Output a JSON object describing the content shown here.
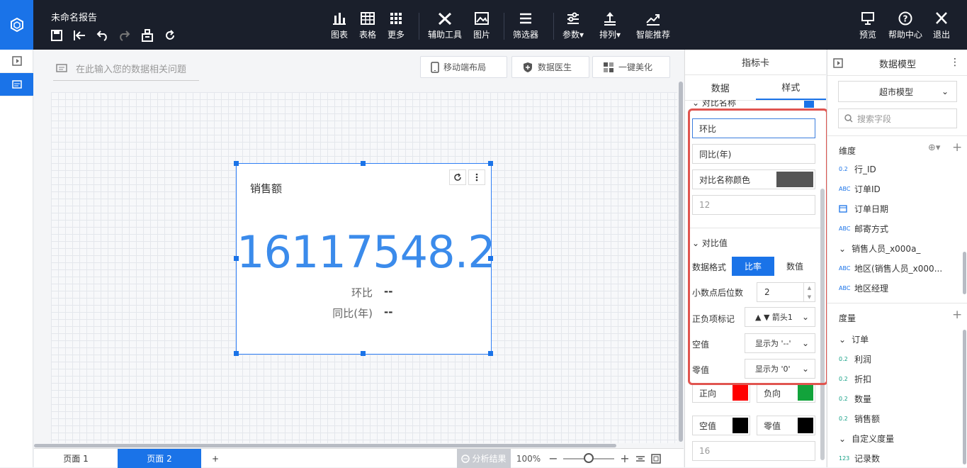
{
  "header": {
    "title": "未命名报告",
    "tools": [
      {
        "label": "图表",
        "icon": "bar-chart-icon"
      },
      {
        "label": "表格",
        "icon": "table-icon"
      },
      {
        "label": "更多",
        "icon": "grid-more-icon"
      },
      {
        "label": "辅助工具",
        "icon": "tools-icon"
      },
      {
        "label": "图片",
        "icon": "image-icon"
      },
      {
        "label": "筛选器",
        "icon": "filter-list-icon"
      },
      {
        "label": "参数",
        "icon": "params-icon"
      },
      {
        "label": "排列",
        "icon": "arrange-icon"
      },
      {
        "label": "智能推荐",
        "icon": "smart-recommend-icon"
      }
    ],
    "right": [
      {
        "label": "预览",
        "icon": "preview-icon"
      },
      {
        "label": "帮助中心",
        "icon": "help-icon"
      },
      {
        "label": "退出",
        "icon": "close-icon"
      }
    ]
  },
  "canvas": {
    "ask_placeholder": "在此输入您的数据相关问题",
    "mobile_layout": "移动端布局",
    "data_doctor": "数据医生",
    "beautify": "一键美化"
  },
  "card": {
    "title": "销售额",
    "value": "16117548.2",
    "cmp1_label": "环比",
    "cmp1_value": "--",
    "cmp2_label": "同比(年)",
    "cmp2_value": "--"
  },
  "pages": {
    "page1": "页面 1",
    "page2": "页面 2",
    "add": "+",
    "analysis": "分析结果",
    "zoom": "100%"
  },
  "panel": {
    "title": "指标卡",
    "tab_data": "数据",
    "tab_style": "样式",
    "section_cmp_name": "对比名称",
    "cmp_name_1": "环比",
    "cmp_name_2": "同比(年)",
    "cmp_name_color": "对比名称颜色",
    "font_size": "12",
    "section_cmp_value": "对比值",
    "data_format": "数据格式",
    "fmt_ratio": "比率",
    "fmt_value": "数值",
    "decimals_label": "小数点后位数",
    "decimals": "2",
    "sign_label": "正负项标记",
    "sign_value": "箭头1",
    "null_label": "空值",
    "null_value": "显示为 '--'",
    "zero_label": "零值",
    "zero_value": "显示为 '0'",
    "positive": "正向",
    "negative": "负向",
    "null2": "空值",
    "zero2": "零值",
    "font_size2": "16",
    "colors": {
      "positive": "#ff0000",
      "negative": "#12a33b",
      "null": "#000000",
      "zero": "#000000",
      "name": "#555555"
    }
  },
  "model": {
    "title": "数据模型",
    "dataset": "超市模型",
    "search_placeholder": "搜索字段",
    "dim_header": "维度",
    "dimensions": [
      {
        "tag": "0.2",
        "name": "行_ID"
      },
      {
        "tag": "ABC",
        "name": "订单ID"
      },
      {
        "tag": "date",
        "name": "订单日期"
      },
      {
        "tag": "ABC",
        "name": "邮寄方式"
      },
      {
        "tag": "folder",
        "name": "销售人员_x000a_"
      },
      {
        "tag": "ABC",
        "name": "地区(销售人员_x000..."
      },
      {
        "tag": "ABC",
        "name": "地区经理"
      }
    ],
    "measure_header": "度量",
    "measures": [
      {
        "tag": "folder",
        "name": "订单"
      },
      {
        "tag": "0.2",
        "name": "利润"
      },
      {
        "tag": "0.2",
        "name": "折扣"
      },
      {
        "tag": "0.2",
        "name": "数量"
      },
      {
        "tag": "0.2",
        "name": "销售额"
      },
      {
        "tag": "folder",
        "name": "自定义度量"
      },
      {
        "tag": "123",
        "name": "记录数"
      }
    ]
  }
}
